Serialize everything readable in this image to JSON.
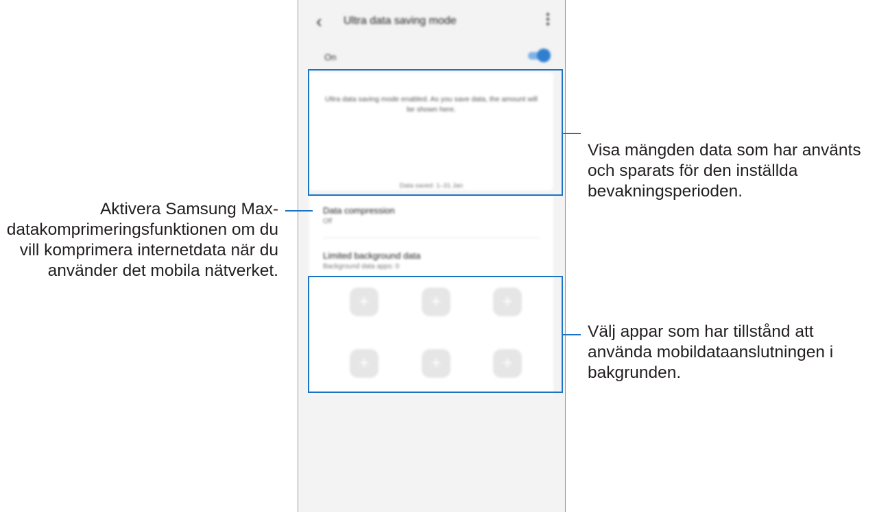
{
  "screen": {
    "title": "Ultra data saving mode",
    "switch_label": "On",
    "toggle_on": true,
    "info_text": "Ultra data saving mode enabled. As you save data, the amount will be shown here.",
    "info_period": "Data saved: 1–31 Jan",
    "settings": [
      {
        "title": "Data compression",
        "subtitle": "Off"
      },
      {
        "title": "Limited background data",
        "subtitle": "Background data apps: 0"
      }
    ],
    "app_slots": [
      "+",
      "+",
      "+",
      "+",
      "+",
      "+"
    ]
  },
  "callouts": {
    "data_amount": "Visa mängden data som har använts och sparats för den inställda bevakningsperioden.",
    "compression": "Aktivera Samsung Max-datakomprimeringsfunktionen om du vill komprimera internetdata när du använder det mobila nätverket.",
    "background_apps": "Välj appar som har tillstånd att använda mobildataanslutningen i bakgrunden."
  },
  "colors": {
    "accent": "#1a73c4",
    "toggle": "#2f7fd0"
  }
}
